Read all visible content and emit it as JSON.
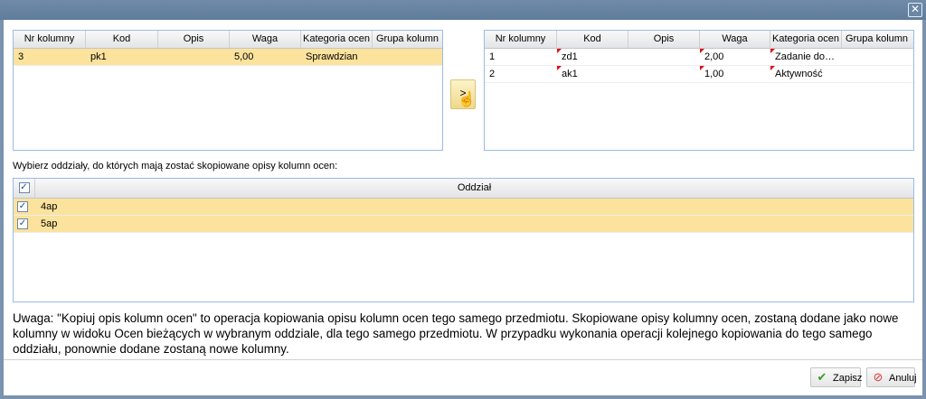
{
  "window": {
    "close_glyph": "✕"
  },
  "left_grid": {
    "headers": [
      "Nr kolumny",
      "Kod",
      "Opis",
      "Waga",
      "Kategoria ocen",
      "Grupa kolumn"
    ],
    "rows": [
      {
        "nr": "3",
        "kod": "pk1",
        "opis": "",
        "waga": "5,00",
        "kategoria": "Sprawdzian",
        "grupa": ""
      }
    ]
  },
  "copy_button": {
    "label": ">"
  },
  "right_grid": {
    "headers": [
      "Nr kolumny",
      "Kod",
      "Opis",
      "Waga",
      "Kategoria ocen",
      "Grupa kolumn"
    ],
    "rows": [
      {
        "nr": "1",
        "kod": "zd1",
        "opis": "",
        "waga": "2,00",
        "kategoria": "Zadanie dom...",
        "grupa": ""
      },
      {
        "nr": "2",
        "kod": "ak1",
        "opis": "",
        "waga": "1,00",
        "kategoria": "Aktywność",
        "grupa": ""
      }
    ]
  },
  "instruction": "Wybierz oddziały, do których mają zostać skopiowane opisy kolumn ocen:",
  "class_grid": {
    "header": "Oddział",
    "rows": [
      {
        "name": "4ap",
        "checked": true
      },
      {
        "name": "5ap",
        "checked": true
      }
    ]
  },
  "note": "Uwaga: \"Kopiuj opis kolumn ocen\" to operacja kopiowania opisu kolumn ocen tego samego przedmiotu. Skopiowane opisy kolumny ocen, zostaną dodane jako nowe kolumny w widoku Ocen bieżących w wybranym oddziale, dla tego samego przedmiotu. W przypadku wykonania operacji kolejnego kopiowania do tego samego oddziału, ponownie dodane zostaną nowe kolumny.",
  "buttons": {
    "save": "Zapisz",
    "cancel": "Anuluj"
  },
  "colors": {
    "accent": "#99bbe8",
    "selected_row": "#fbe39d",
    "titlebar": "#6a87a6"
  }
}
